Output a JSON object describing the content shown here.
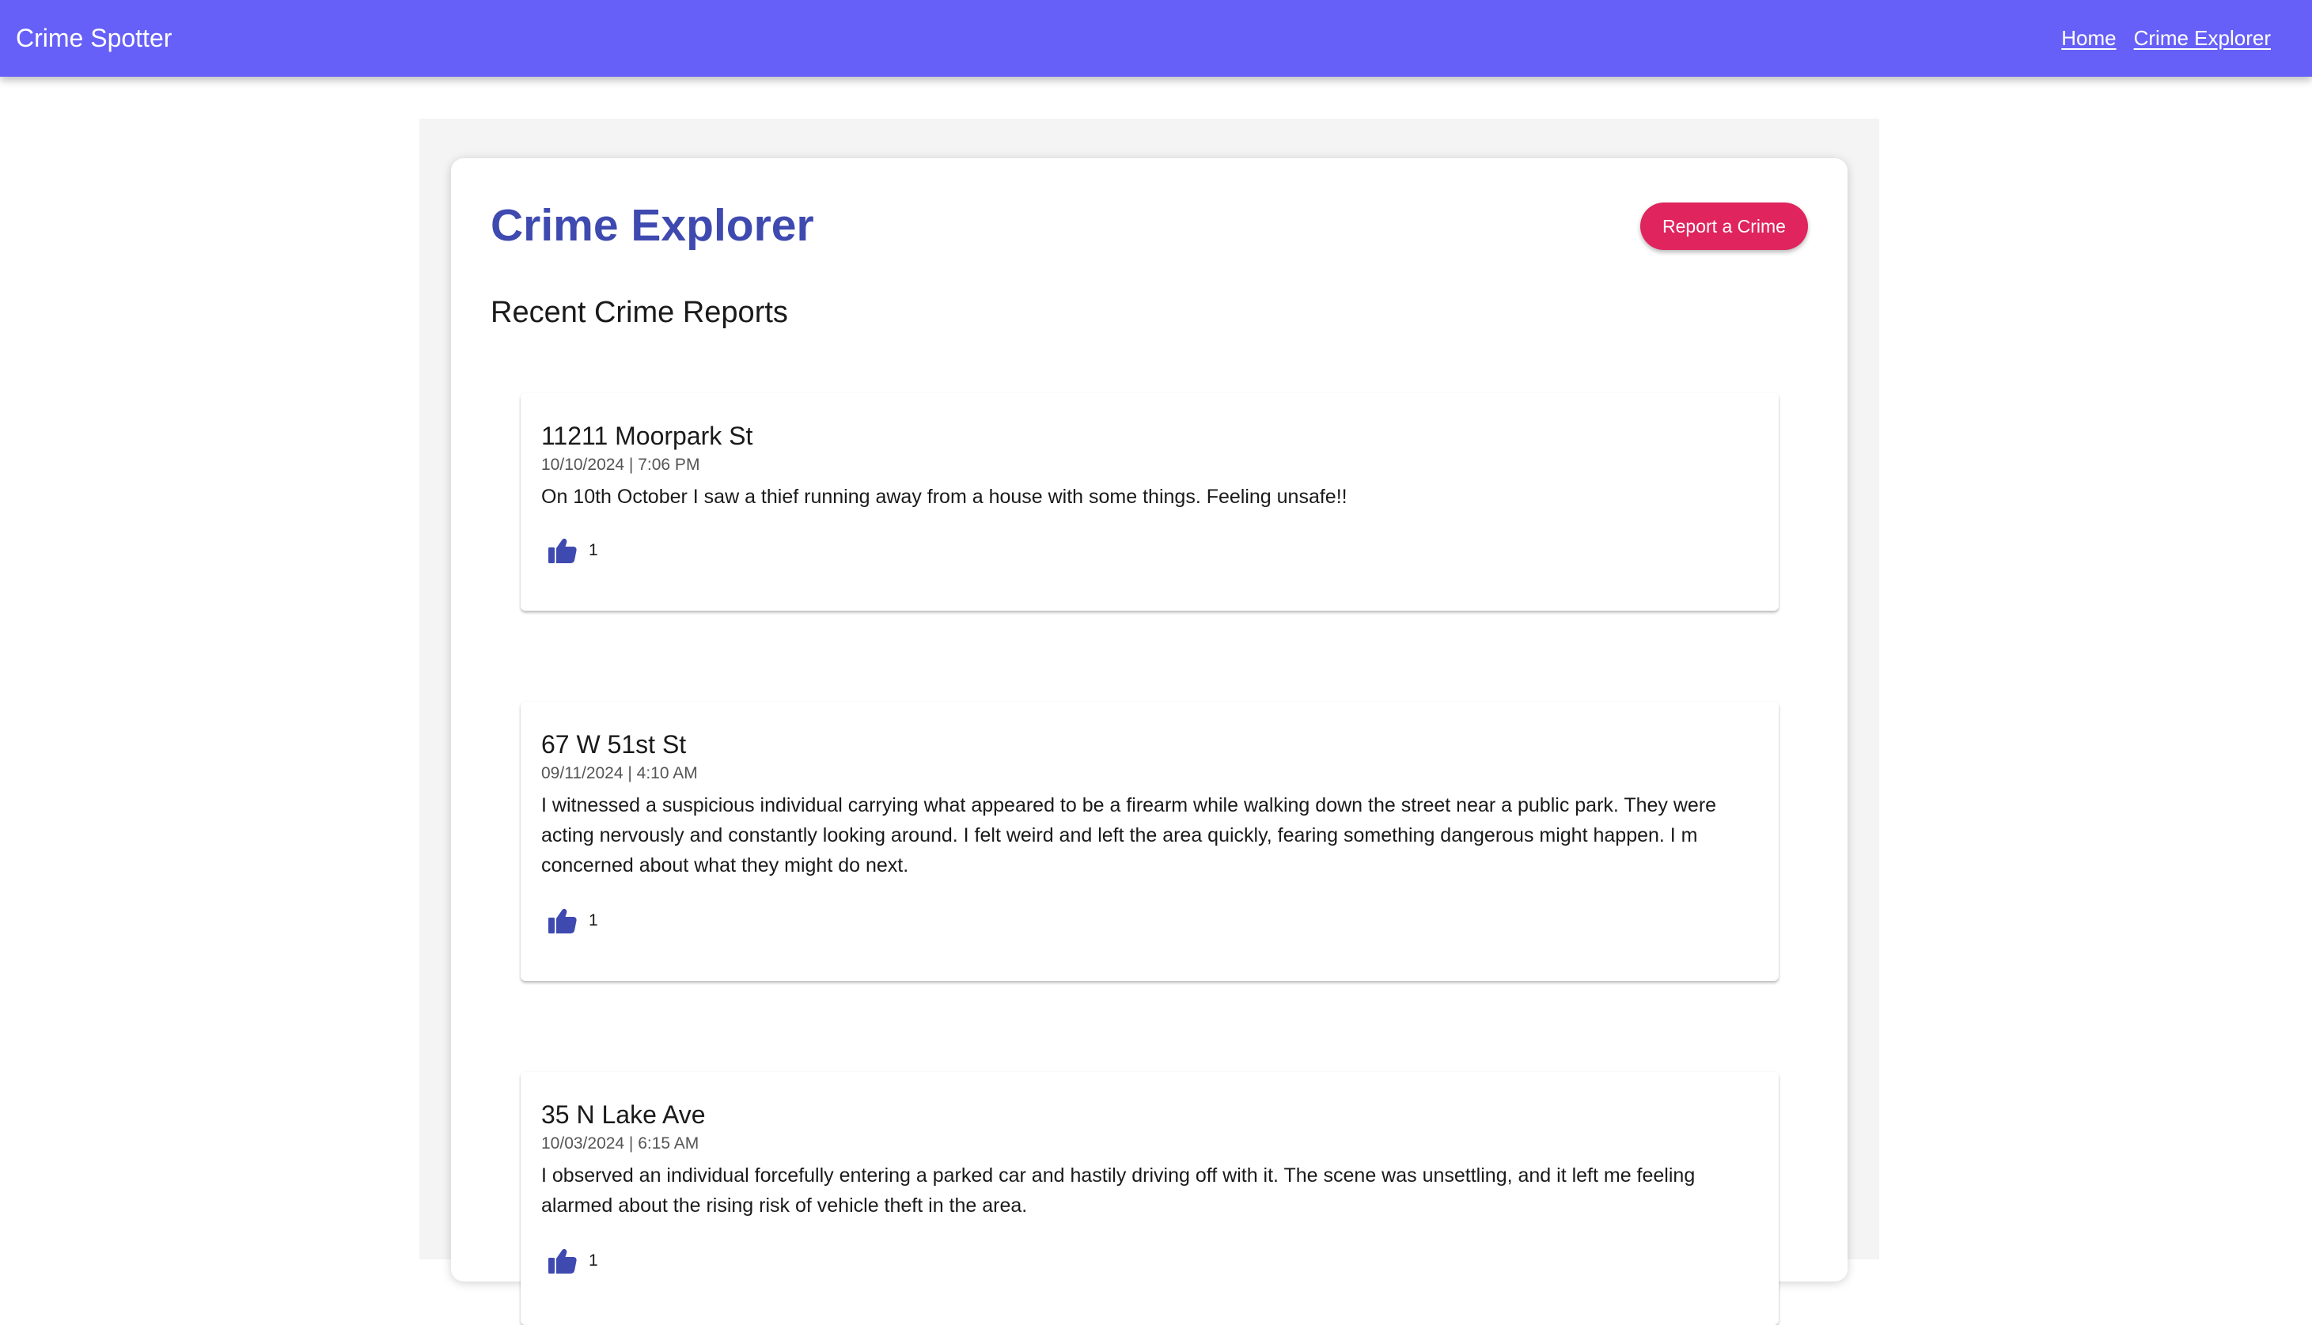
{
  "app": {
    "brand": "Crime Spotter",
    "nav": [
      "Home",
      "Crime Explorer"
    ]
  },
  "page": {
    "title": "Crime Explorer",
    "report_button": "Report a Crime",
    "section_title": "Recent Crime Reports"
  },
  "reports": [
    {
      "address": "11211 Moorpark St",
      "datetime": "10/10/2024 | 7:06 PM",
      "description": "On 10th October I saw a thief running away from a house with some things. Feeling unsafe!!",
      "likes": "1"
    },
    {
      "address": "67 W 51st St",
      "datetime": "09/11/2024 | 4:10 AM",
      "description": "I witnessed a suspicious individual carrying what appeared to be a firearm while walking down the street near a public park. They were acting nervously and constantly looking around. I felt weird and left the area quickly, fearing something dangerous might happen. I m concerned about what they might do next.",
      "likes": "1"
    },
    {
      "address": "35 N Lake Ave",
      "datetime": "10/03/2024 | 6:15 AM",
      "description": "I observed an individual forcefully entering a parked car and hastily driving off with it. The scene was unsettling, and it left me feeling alarmed about the rising risk of vehicle theft in the area.",
      "likes": "1"
    }
  ],
  "colors": {
    "topbar": "#6660f8",
    "title": "#3f4ab0",
    "report_button": "#e0245e",
    "like_icon": "#3f4ab0"
  },
  "icons": {
    "like": "thumbs-up-icon"
  }
}
